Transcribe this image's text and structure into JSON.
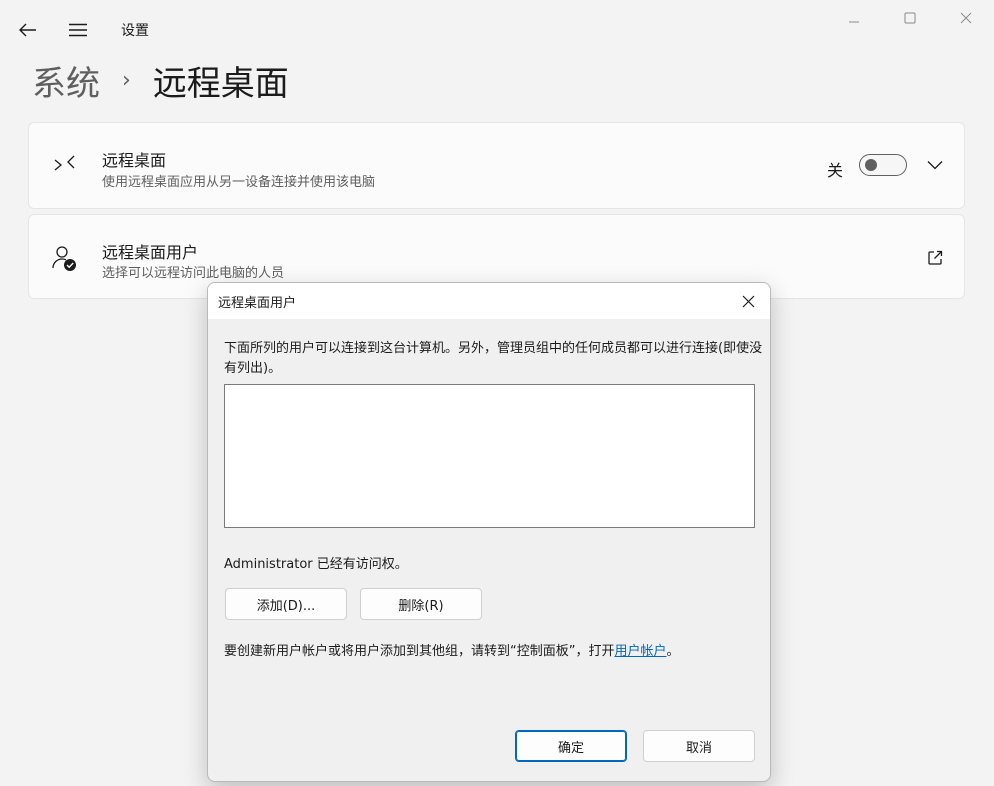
{
  "app": {
    "title": "设置"
  },
  "breadcrumb": {
    "parent": "系统",
    "separator": "›",
    "current": "远程桌面"
  },
  "cards": {
    "remote_desktop": {
      "title": "远程桌面",
      "subtitle": "使用远程桌面应用从另一设备连接并使用该电脑",
      "toggle_state_label": "关",
      "toggle_on": false
    },
    "remote_users": {
      "title": "远程桌面用户",
      "subtitle": "选择可以远程访问此电脑的人员"
    }
  },
  "dialog": {
    "title": "远程桌面用户",
    "description": "下面所列的用户可以连接到这台计算机。另外，管理员组中的任何成员都可以进行连接(即使没有列出)。",
    "users": [],
    "access_text": "Administrator 已经有访问权。",
    "add_button": "添加(D)...",
    "remove_button": "删除(R)",
    "note_prefix": "要创建新用户帐户或将用户添加到其他组，请转到“控制面板”，打开",
    "note_link": "用户帐户",
    "note_suffix": "。",
    "ok_button": "确定",
    "cancel_button": "取消"
  },
  "colors": {
    "accent": "#0067c0",
    "background": "#f3f3f3",
    "card": "#fbfbfb"
  }
}
